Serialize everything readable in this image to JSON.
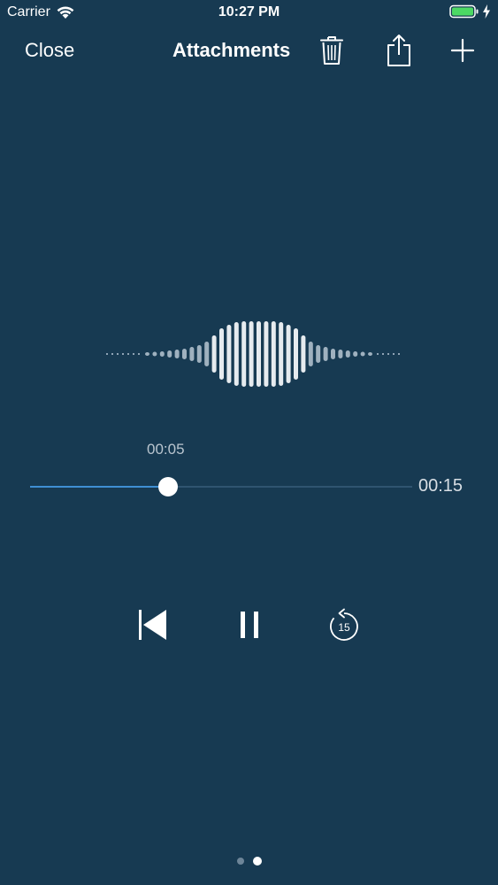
{
  "status_bar": {
    "carrier": "Carrier",
    "time": "10:27 PM",
    "battery_color": "#4cd964"
  },
  "nav": {
    "close_label": "Close",
    "title": "Attachments",
    "icons": [
      "trash-icon",
      "share-icon",
      "plus-icon"
    ]
  },
  "player": {
    "current_time": "00:05",
    "duration": "00:15",
    "progress_fraction": 0.36,
    "accent_color": "#3f8fd3",
    "background_color": "#173a52",
    "controls": [
      "rewind-to-start-icon",
      "pause-icon",
      "skip-back-15-icon"
    ],
    "skip_back_label": "15"
  },
  "pager": {
    "pages": 2,
    "active_index": 1
  }
}
